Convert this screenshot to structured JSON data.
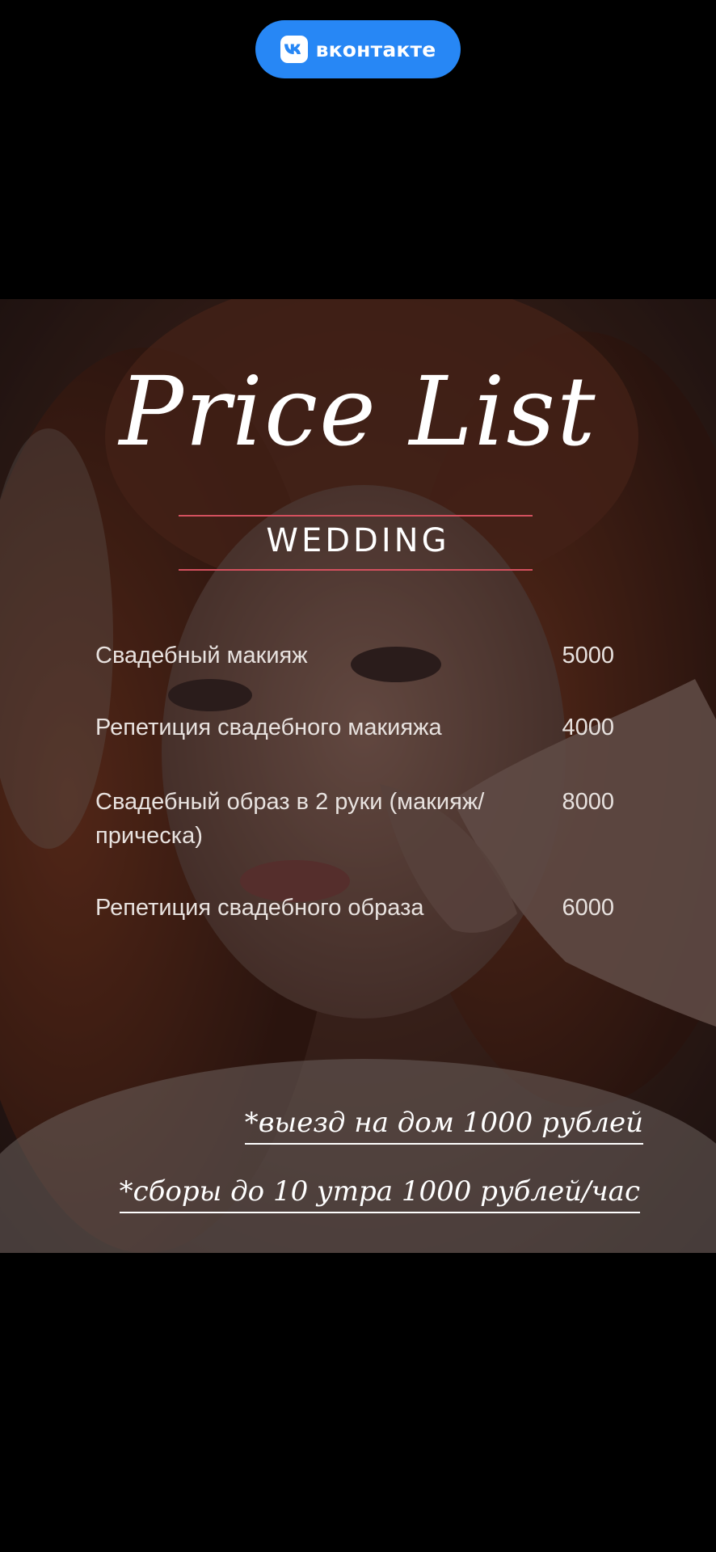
{
  "vk_button": {
    "label": "вконтакте",
    "icon": "vk-logo-icon",
    "color": "#2787f5"
  },
  "story": {
    "title": "Price List",
    "section": "WEDDING",
    "accent_color": "#d4505e",
    "items": [
      {
        "name": "Свадебный макияж",
        "price": "5000"
      },
      {
        "name": "Репетиция свадебного макияжа",
        "price": "4000"
      },
      {
        "name": "Свадебный образ в 2 руки (макияж/ прическа)",
        "price": "8000"
      },
      {
        "name": "Репетиция свадебного образа",
        "price": "6000"
      }
    ],
    "notes": [
      "*выезд на дом 1000 рублей",
      "*сборы до 10 утра 1000 рублей/час"
    ]
  }
}
